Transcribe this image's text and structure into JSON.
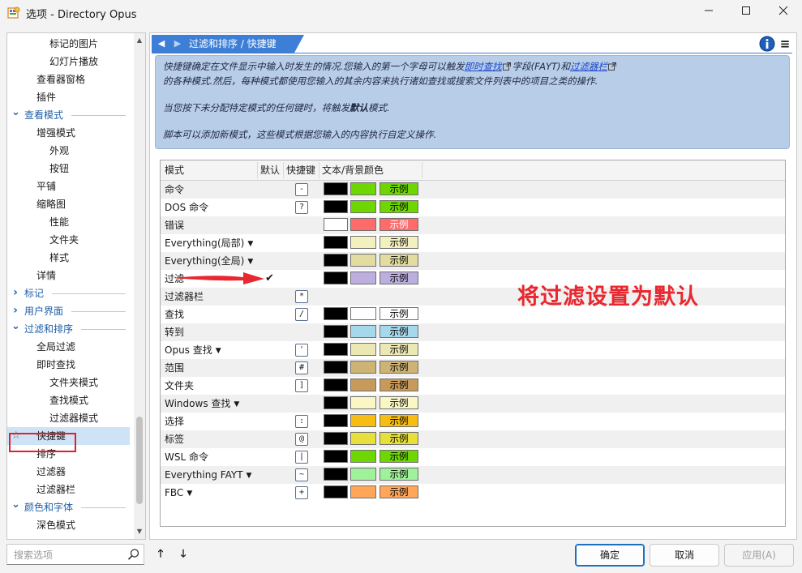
{
  "window": {
    "title": "选项 - Directory Opus",
    "controls": [
      "minimize",
      "maximize",
      "close"
    ]
  },
  "sidebar": {
    "items": [
      {
        "label": "标记的图片",
        "level": 2
      },
      {
        "label": "幻灯片播放",
        "level": 2
      },
      {
        "label": "查看器窗格",
        "level": 1
      },
      {
        "label": "插件",
        "level": 1
      },
      {
        "label": "查看模式",
        "level": 0,
        "expanded": true
      },
      {
        "label": "增强模式",
        "level": 1
      },
      {
        "label": "外观",
        "level": 2
      },
      {
        "label": "按钮",
        "level": 2
      },
      {
        "label": "平铺",
        "level": 1
      },
      {
        "label": "缩略图",
        "level": 1
      },
      {
        "label": "性能",
        "level": 2
      },
      {
        "label": "文件夹",
        "level": 2
      },
      {
        "label": "样式",
        "level": 2
      },
      {
        "label": "详情",
        "level": 1
      },
      {
        "label": "标记",
        "level": 0,
        "expanded": false
      },
      {
        "label": "用户界面",
        "level": 0,
        "expanded": false
      },
      {
        "label": "过滤和排序",
        "level": 0,
        "expanded": true
      },
      {
        "label": "全局过滤",
        "level": 1
      },
      {
        "label": "即时查找",
        "level": 1
      },
      {
        "label": "文件夹模式",
        "level": 2
      },
      {
        "label": "查找模式",
        "level": 2
      },
      {
        "label": "过滤器模式",
        "level": 2
      },
      {
        "label": "快捷键",
        "level": 1,
        "selected": true
      },
      {
        "label": "排序",
        "level": 1
      },
      {
        "label": "过滤器",
        "level": 1
      },
      {
        "label": "过滤器栏",
        "level": 1
      },
      {
        "label": "颜色和字体",
        "level": 0,
        "expanded": true
      },
      {
        "label": "深色模式",
        "level": 1
      }
    ]
  },
  "search": {
    "placeholder": "搜索选项"
  },
  "breadcrumb": {
    "text": "过滤和排序 / 快捷键"
  },
  "info": {
    "line1_pre": "快捷键确定在文件显示中输入时发生的情况.您输入的第一个字母可以触发",
    "link1": "即时查找",
    "line1_mid": "字段(FAYT)和",
    "link2": "过滤器栏",
    "line2": "的各种模式.然后，每种模式都使用您输入的其余内容来执行诸如查找或搜索文件列表中的项目之类的操作.",
    "line3_pre": "当您按下未分配特定模式的任何键时，将触发",
    "line3_bold": "默认",
    "line3_post": "模式.",
    "line4": "脚本可以添加新模式，这些模式根据您输入的内容执行自定义操作."
  },
  "grid": {
    "columns": [
      "模式",
      "默认",
      "快捷键",
      "文本/背景颜色"
    ],
    "sample_label": "示例",
    "rows": [
      {
        "mode": "命令",
        "dropdown": false,
        "default": false,
        "key": "-",
        "fg": "#000000",
        "bg": "#6ed600"
      },
      {
        "mode": "DOS 命令",
        "dropdown": false,
        "default": false,
        "key": "?",
        "fg": "#000000",
        "bg": "#6ed600"
      },
      {
        "mode": "错误",
        "dropdown": false,
        "default": false,
        "key": "",
        "fg": "#ffffff",
        "bg": "#ff6b6b"
      },
      {
        "mode": "Everything(局部)",
        "dropdown": true,
        "default": false,
        "key": "",
        "fg": "#000000",
        "bg": "#f3f0c0"
      },
      {
        "mode": "Everything(全局)",
        "dropdown": true,
        "default": false,
        "key": "",
        "fg": "#000000",
        "bg": "#e2dca0"
      },
      {
        "mode": "过滤",
        "dropdown": false,
        "default": true,
        "key": "",
        "fg": "#000000",
        "bg": "#bdaee0"
      },
      {
        "mode": "过滤器栏",
        "dropdown": false,
        "default": false,
        "key": "*",
        "fg": null,
        "bg": null
      },
      {
        "mode": "查找",
        "dropdown": false,
        "default": false,
        "key": "/",
        "fg": "#000000",
        "bg": "#ffffff"
      },
      {
        "mode": "转到",
        "dropdown": false,
        "default": false,
        "key": "",
        "fg": "#000000",
        "bg": "#a6d8ec"
      },
      {
        "mode": "Opus 查找",
        "dropdown": true,
        "default": false,
        "key": "'",
        "fg": "#000000",
        "bg": "#ece8b4"
      },
      {
        "mode": "范围",
        "dropdown": false,
        "default": false,
        "key": "#",
        "fg": "#000000",
        "bg": "#cdb474"
      },
      {
        "mode": "文件夹",
        "dropdown": false,
        "default": false,
        "key": "]",
        "fg": "#000000",
        "bg": "#c79a5c"
      },
      {
        "mode": "Windows 查找",
        "dropdown": true,
        "default": false,
        "key": "",
        "fg": "#000000",
        "bg": "#faf7c4"
      },
      {
        "mode": "选择",
        "dropdown": false,
        "default": false,
        "key": ":",
        "fg": "#000000",
        "bg": "#f7bd12"
      },
      {
        "mode": "标签",
        "dropdown": false,
        "default": false,
        "key": "@",
        "fg": "#000000",
        "bg": "#e8e03a"
      },
      {
        "mode": "WSL 命令",
        "dropdown": false,
        "default": false,
        "key": "|",
        "fg": "#000000",
        "bg": "#6ed600"
      },
      {
        "mode": "Everything FAYT",
        "dropdown": true,
        "default": false,
        "key": "~",
        "fg": "#000000",
        "bg": "#a0f29a"
      },
      {
        "mode": "FBC",
        "dropdown": true,
        "default": false,
        "key": "+",
        "fg": "#000000",
        "bg": "#ffa658"
      }
    ]
  },
  "annotation": {
    "text": "将过滤设置为默认"
  },
  "buttons": {
    "ok": "确定",
    "cancel": "取消",
    "apply": "应用(A)"
  },
  "colors": {
    "accent": "#3d7fd6",
    "annotation": "#e8272e",
    "link": "#1a47c8"
  }
}
